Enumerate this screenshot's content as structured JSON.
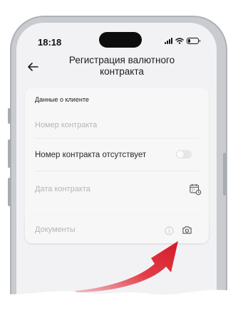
{
  "status_bar": {
    "time": "18:18"
  },
  "header": {
    "title": "Регистрация валютного контракта"
  },
  "form": {
    "section_label": "Данные о клиенте",
    "contract_number_placeholder": "Номер контракта",
    "no_contract_label": "Номер контракта отсутствует",
    "no_contract_toggle_on": false,
    "contract_date_placeholder": "Дата контракта",
    "documents_placeholder": "Документы"
  },
  "icons": {
    "back": "arrow-left-icon",
    "calendar": "calendar-icon",
    "info": "info-icon",
    "camera": "camera-icon"
  },
  "colors": {
    "screen_bg": "#f2f2f4",
    "card_bg": "#f7f7f8",
    "placeholder": "#b5b5ba",
    "arrow_red": "#e01e2b"
  }
}
